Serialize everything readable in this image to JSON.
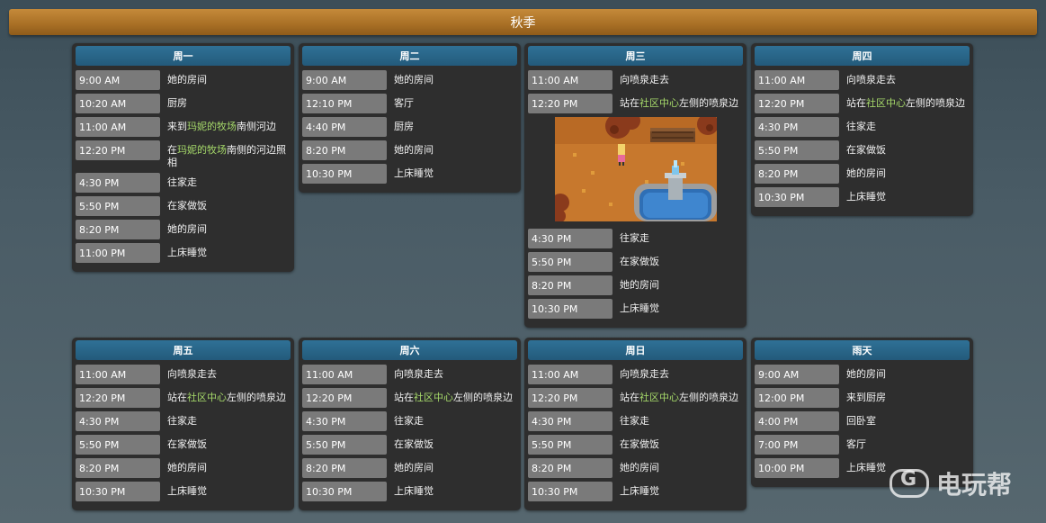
{
  "title": "秋季",
  "days": {
    "mon": {
      "name": "周一",
      "rows": [
        {
          "time": "9:00 AM",
          "act": "她的房间"
        },
        {
          "time": "10:20 AM",
          "act": "厨房"
        },
        {
          "time": "11:00 AM",
          "pre": "来到",
          "hl": "玛妮的牧场",
          "post": "南侧河边"
        },
        {
          "time": "12:20 PM",
          "pre": "在",
          "hl": "玛妮的牧场",
          "post": "南侧的河边照相"
        },
        {
          "time": "4:30 PM",
          "act": "往家走"
        },
        {
          "time": "5:50 PM",
          "act": "在家做饭"
        },
        {
          "time": "8:20 PM",
          "act": "她的房间"
        },
        {
          "time": "11:00 PM",
          "act": "上床睡觉"
        }
      ]
    },
    "tue": {
      "name": "周二",
      "rows": [
        {
          "time": "9:00 AM",
          "act": "她的房间"
        },
        {
          "time": "12:10 PM",
          "act": "客厅"
        },
        {
          "time": "4:40 PM",
          "act": "厨房"
        },
        {
          "time": "8:20 PM",
          "act": "她的房间"
        },
        {
          "time": "10:30 PM",
          "act": "上床睡觉"
        }
      ]
    },
    "wed": {
      "name": "周三",
      "rows_top": [
        {
          "time": "11:00 AM",
          "act": "向喷泉走去"
        },
        {
          "time": "12:20 PM",
          "pre": "站在",
          "hl": "社区中心",
          "post": "左侧的喷泉边"
        }
      ],
      "rows_bottom": [
        {
          "time": "4:30 PM",
          "act": "往家走"
        },
        {
          "time": "5:50 PM",
          "act": "在家做饭"
        },
        {
          "time": "8:20 PM",
          "act": "她的房间"
        },
        {
          "time": "10:30 PM",
          "act": "上床睡觉"
        }
      ]
    },
    "thu": {
      "name": "周四",
      "rows": [
        {
          "time": "11:00 AM",
          "act": "向喷泉走去"
        },
        {
          "time": "12:20 PM",
          "pre": "站在",
          "hl": "社区中心",
          "post": "左侧的喷泉边"
        },
        {
          "time": "4:30 PM",
          "act": "往家走"
        },
        {
          "time": "5:50 PM",
          "act": "在家做饭"
        },
        {
          "time": "8:20 PM",
          "act": "她的房间"
        },
        {
          "time": "10:30 PM",
          "act": "上床睡觉"
        }
      ]
    },
    "fri": {
      "name": "周五",
      "rows": [
        {
          "time": "11:00 AM",
          "act": "向喷泉走去"
        },
        {
          "time": "12:20 PM",
          "pre": "站在",
          "hl": "社区中心",
          "post": "左侧的喷泉边"
        },
        {
          "time": "4:30 PM",
          "act": "往家走"
        },
        {
          "time": "5:50 PM",
          "act": "在家做饭"
        },
        {
          "time": "8:20 PM",
          "act": "她的房间"
        },
        {
          "time": "10:30 PM",
          "act": "上床睡觉"
        }
      ]
    },
    "sat": {
      "name": "周六",
      "rows": [
        {
          "time": "11:00 AM",
          "act": "向喷泉走去"
        },
        {
          "time": "12:20 PM",
          "pre": "站在",
          "hl": "社区中心",
          "post": "左侧的喷泉边"
        },
        {
          "time": "4:30 PM",
          "act": "往家走"
        },
        {
          "time": "5:50 PM",
          "act": "在家做饭"
        },
        {
          "time": "8:20 PM",
          "act": "她的房间"
        },
        {
          "time": "10:30 PM",
          "act": "上床睡觉"
        }
      ]
    },
    "sun": {
      "name": "周日",
      "rows": [
        {
          "time": "11:00 AM",
          "act": "向喷泉走去"
        },
        {
          "time": "12:20 PM",
          "pre": "站在",
          "hl": "社区中心",
          "post": "左侧的喷泉边"
        },
        {
          "time": "4:30 PM",
          "act": "往家走"
        },
        {
          "time": "5:50 PM",
          "act": "在家做饭"
        },
        {
          "time": "8:20 PM",
          "act": "她的房间"
        },
        {
          "time": "10:30 PM",
          "act": "上床睡觉"
        }
      ]
    },
    "rain": {
      "name": "雨天",
      "rows": [
        {
          "time": "9:00 AM",
          "act": "她的房间"
        },
        {
          "time": "12:00 PM",
          "act": "来到厨房"
        },
        {
          "time": "4:00 PM",
          "act": "回卧室"
        },
        {
          "time": "7:00 PM",
          "act": "客厅"
        },
        {
          "time": "10:00 PM",
          "act": "上床睡觉"
        }
      ]
    }
  },
  "watermark": "电玩帮",
  "colors": {
    "header": "#a86f25",
    "day_head": "#2a6689",
    "highlight": "#a6d96a",
    "time_cell": "#7a7a7a",
    "panel": "#2e2e2e"
  }
}
